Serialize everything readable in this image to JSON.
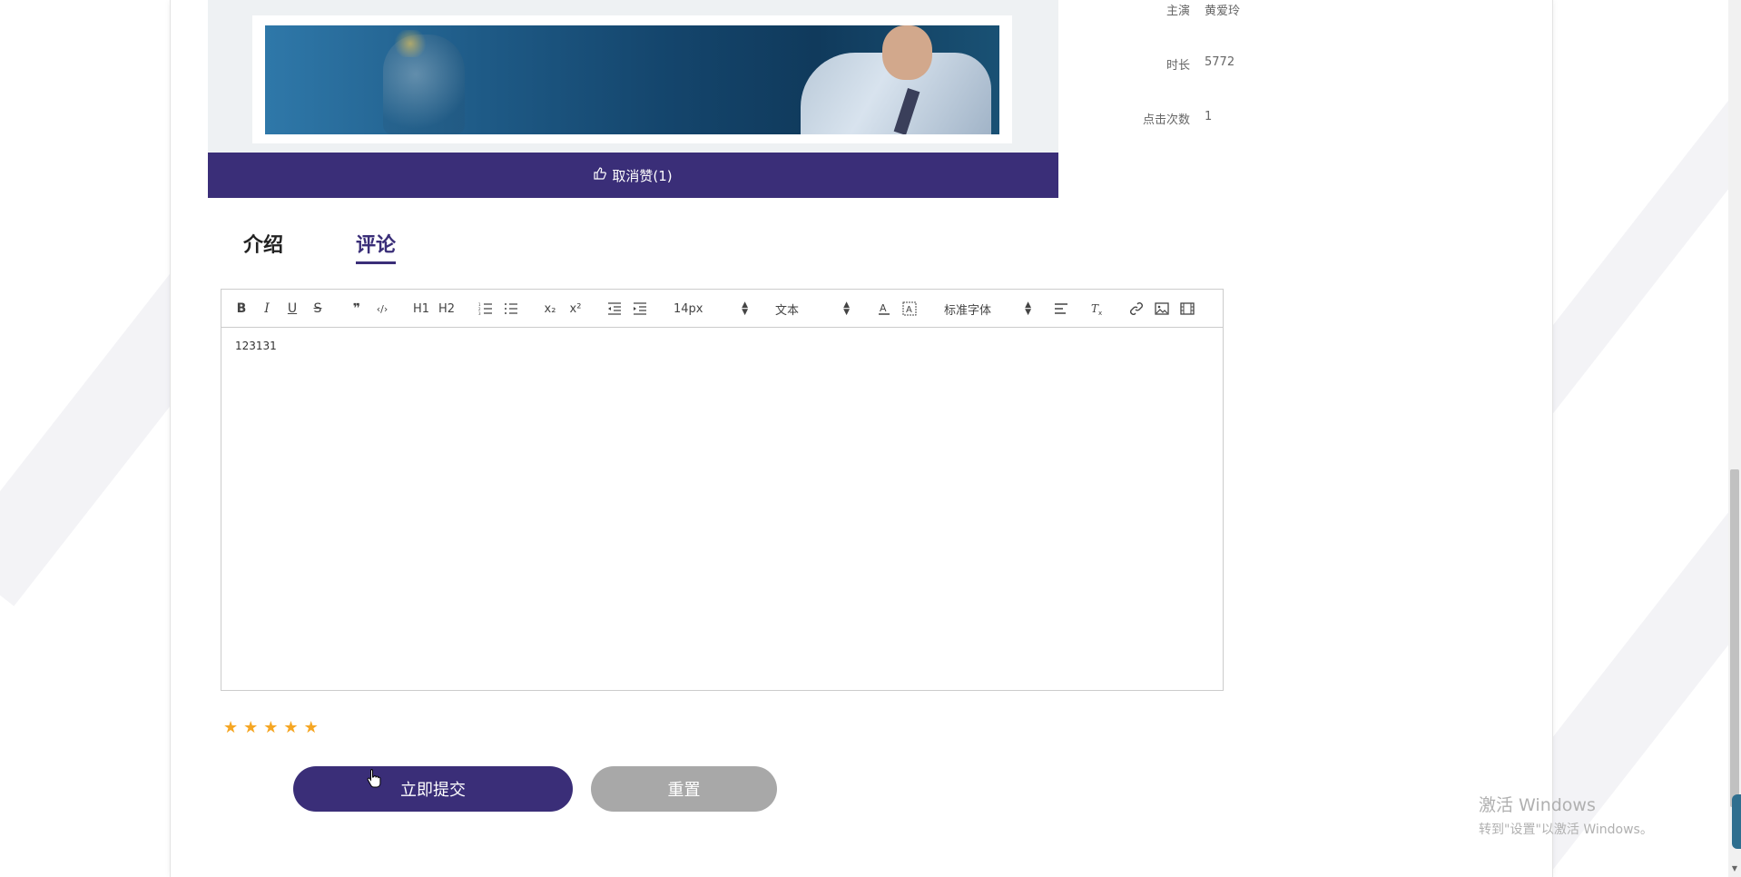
{
  "like_button": {
    "label": "取消赞(1)"
  },
  "info": [
    {
      "label": "主演",
      "value": "黄爱玲"
    },
    {
      "label": "时长",
      "value": "5772"
    },
    {
      "label": "点击次数",
      "value": "1"
    }
  ],
  "tabs": [
    {
      "label": "介绍",
      "active": false
    },
    {
      "label": "评论",
      "active": true
    }
  ],
  "editor": {
    "toolbar": {
      "bold": "B",
      "italic": "I",
      "underline": "U",
      "strike": "S",
      "quote": "❞",
      "code": "‹/›",
      "h1": "H1",
      "h2": "H2",
      "subscript": "x₂",
      "superscript": "x²",
      "size_value": "14px",
      "header_value": "文本",
      "font_value": "标准字体"
    },
    "content": "123131"
  },
  "rating": {
    "stars": 5,
    "max": 5
  },
  "buttons": {
    "submit": "立即提交",
    "reset": "重置"
  },
  "watermark": {
    "title": "激活 Windows",
    "subtitle": "转到\"设置\"以激活 Windows。"
  },
  "colors": {
    "primary": "#3a2e78",
    "star": "#f5a623",
    "reset": "#a8a8a8"
  }
}
